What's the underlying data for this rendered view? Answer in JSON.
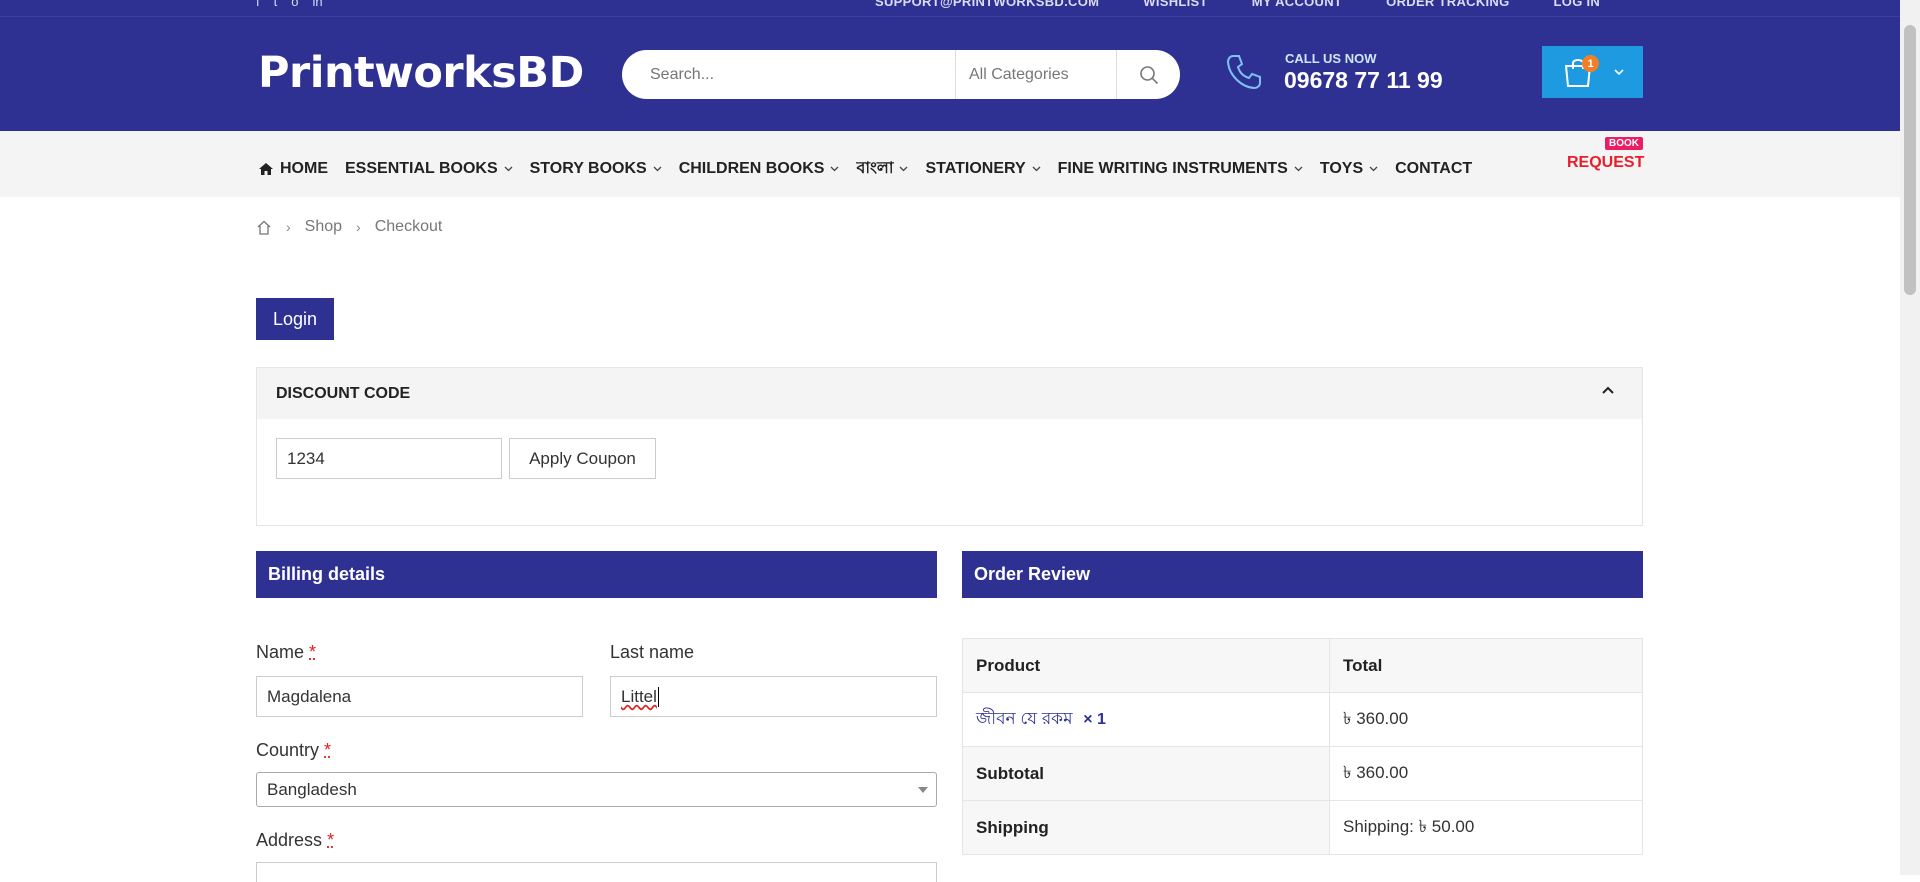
{
  "header": {
    "social": [
      "f",
      "t",
      "o",
      "in"
    ],
    "top_links": [
      "SUPPORT@PRINTWORKSBD.COM",
      "WISHLIST",
      "MY ACCOUNT",
      "ORDER TRACKING",
      "LOG IN"
    ],
    "logo": "PrintworksBD",
    "search_placeholder": "Search...",
    "category": "All Categories",
    "call_label": "CALL US NOW",
    "phone": "09678 77 11 99",
    "cart_count": "1",
    "colors": {
      "brand": "#2e3192",
      "cart": "#1e9be0",
      "badge": "#f47e26",
      "request": "#e91e2c"
    }
  },
  "nav": {
    "home": "HOME",
    "items": [
      {
        "label": "ESSENTIAL BOOKS"
      },
      {
        "label": "STORY BOOKS"
      },
      {
        "label": "CHILDREN BOOKS"
      },
      {
        "label": "বাংলা"
      },
      {
        "label": "STATIONERY"
      },
      {
        "label": "FINE WRITING INSTRUMENTS"
      },
      {
        "label": "TOYS"
      }
    ],
    "contact": "CONTACT",
    "book_tag": "BOOK",
    "request": "REQUEST"
  },
  "breadcrumb": {
    "shop": "Shop",
    "current": "Checkout"
  },
  "login_label": "Login",
  "discount": {
    "title": "DISCOUNT CODE",
    "code_value": "1234",
    "apply_label": "Apply Coupon"
  },
  "billing": {
    "title": "Billing details",
    "name_label": "Name",
    "last_name_label": "Last name",
    "first_name": "Magdalena",
    "last_name": "Littel",
    "country_label": "Country",
    "country": "Bangladesh",
    "address_label": "Address",
    "required_mark": "*"
  },
  "review": {
    "title": "Order Review",
    "col_product": "Product",
    "col_total": "Total",
    "product_name": "জীবন যে রকম",
    "product_qty": "× 1",
    "product_total": "৳ 360.00",
    "subtotal_label": "Subtotal",
    "subtotal": "৳ 360.00",
    "shipping_label": "Shipping",
    "shipping": "Shipping: ৳ 50.00"
  }
}
